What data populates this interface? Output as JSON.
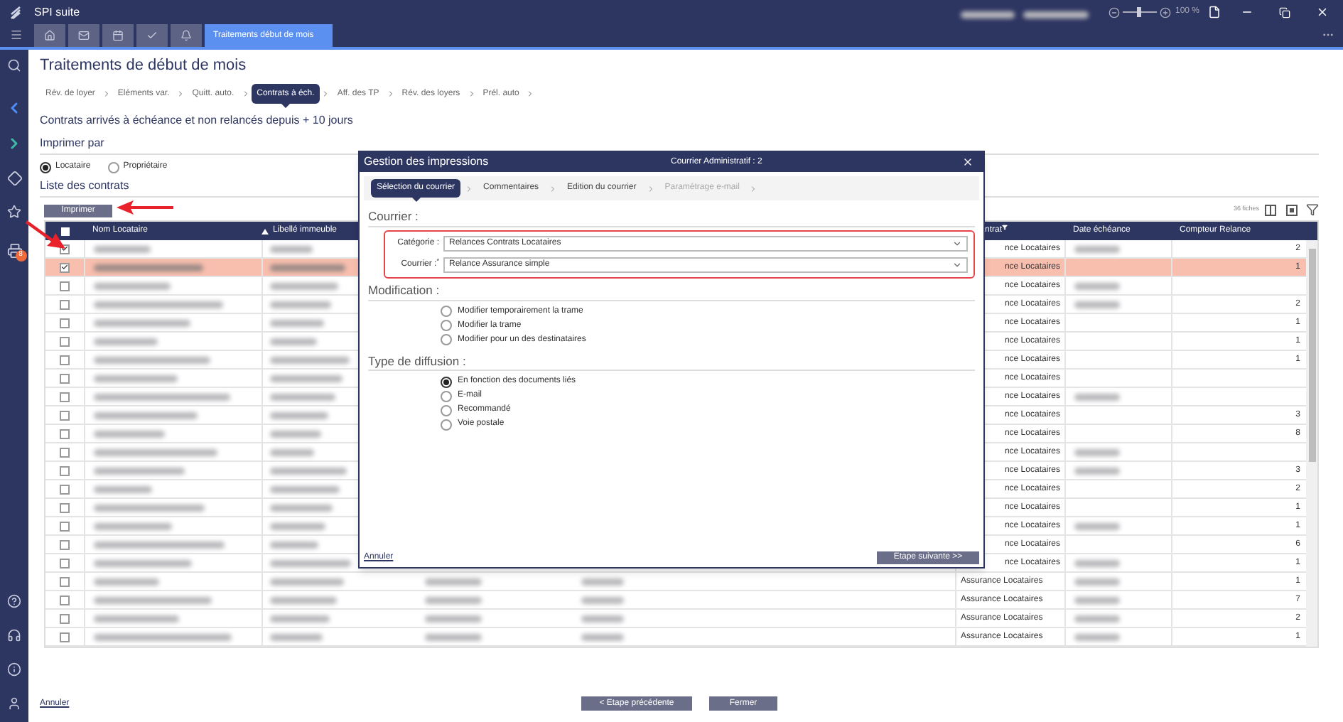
{
  "app": {
    "title": "SPI suite",
    "zoom": {
      "level": 0.5,
      "reading": "100 %"
    }
  },
  "tabs": [
    {
      "kind": "icon",
      "selected": false
    },
    {
      "kind": "icon",
      "selected": false
    },
    {
      "kind": "icon",
      "selected": false
    },
    {
      "kind": "icon",
      "selected": false
    },
    {
      "kind": "icon",
      "selected": false
    },
    {
      "kind": "text",
      "label": "Traitements début de mois",
      "selected": true
    }
  ],
  "sidebar": {
    "print_badge": "8"
  },
  "page": {
    "title": "Traitements de début de mois",
    "steps": [
      {
        "label": "Rév. de loyer",
        "selected": false
      },
      {
        "label": "Eléments var.",
        "selected": false
      },
      {
        "label": "Quitt. auto.",
        "selected": false
      },
      {
        "label": "Contrats à éch.",
        "selected": true
      },
      {
        "label": "Aff. des TP",
        "selected": false
      },
      {
        "label": "Rév. des loyers",
        "selected": false
      },
      {
        "label": "Prél. auto",
        "selected": false
      }
    ],
    "subtitle": "Contrats arrivés à échéance et non relancés depuis + 10 jours",
    "print_by": {
      "label": "Imprimer par",
      "options": [
        {
          "label": "Locataire",
          "selected": true
        },
        {
          "label": "Propriétaire",
          "selected": false
        }
      ]
    },
    "list_title": "Liste des contrats",
    "print_button": "Imprimer",
    "count": "36 fiches"
  },
  "table": {
    "select_all_partial": true,
    "columns": [
      "Nom Locataire",
      "Libellé immeuble",
      "ntrat",
      "Date échéance",
      "Compteur Relance"
    ],
    "rows": [
      {
        "kind": "under_dialog",
        "checked": true,
        "selected": false,
        "contract": "nce Locataires",
        "date_redacted": true,
        "counter": "2"
      },
      {
        "kind": "under_dialog",
        "checked": true,
        "selected": true,
        "contract": "nce Locataires",
        "date_redacted": false,
        "counter": "1"
      },
      {
        "kind": "under_dialog",
        "checked": false,
        "selected": false,
        "contract": "nce Locataires",
        "date_redacted": true
      },
      {
        "kind": "under_dialog",
        "checked": false,
        "selected": false,
        "contract": "nce Locataires",
        "date_redacted": true,
        "counter": "2"
      },
      {
        "kind": "under_dialog",
        "checked": false,
        "selected": false,
        "contract": "nce Locataires",
        "date_redacted": false,
        "counter": "1"
      },
      {
        "kind": "under_dialog",
        "checked": false,
        "selected": false,
        "contract": "nce Locataires",
        "date_redacted": false,
        "counter": "1"
      },
      {
        "kind": "under_dialog",
        "checked": false,
        "selected": false,
        "contract": "nce Locataires",
        "date_redacted": false,
        "counter": "1"
      },
      {
        "kind": "under_dialog",
        "checked": false,
        "selected": false,
        "contract": "nce Locataires",
        "date_redacted": false
      },
      {
        "kind": "under_dialog",
        "checked": false,
        "selected": false,
        "contract": "nce Locataires",
        "date_redacted": true
      },
      {
        "kind": "under_dialog",
        "checked": false,
        "selected": false,
        "contract": "nce Locataires",
        "date_redacted": false,
        "counter": "3"
      },
      {
        "kind": "under_dialog",
        "checked": false,
        "selected": false,
        "contract": "nce Locataires",
        "date_redacted": false,
        "counter": "8"
      },
      {
        "kind": "under_dialog",
        "checked": false,
        "selected": false,
        "contract": "nce Locataires",
        "date_redacted": true
      },
      {
        "kind": "under_dialog",
        "checked": false,
        "selected": false,
        "contract": "nce Locataires",
        "date_redacted": true,
        "counter": "3"
      },
      {
        "kind": "under_dialog",
        "checked": false,
        "selected": false,
        "contract": "nce Locataires",
        "date_redacted": false,
        "counter": "2"
      },
      {
        "kind": "under_dialog",
        "checked": false,
        "selected": false,
        "contract": "nce Locataires",
        "date_redacted": false,
        "counter": "1"
      },
      {
        "kind": "under_dialog",
        "checked": false,
        "selected": false,
        "contract": "nce Locataires",
        "date_redacted": true,
        "counter": "1"
      },
      {
        "kind": "under_dialog",
        "checked": false,
        "selected": false,
        "contract": "nce Locataires",
        "date_redacted": false,
        "counter": "6"
      },
      {
        "kind": "under_dialog",
        "checked": false,
        "selected": false,
        "contract": "nce Locataires",
        "date_redacted": true,
        "counter": "1"
      },
      {
        "kind": "visible",
        "checked": false,
        "selected": false,
        "contract": "Assurance Locataires",
        "date_redacted": true,
        "counter": "1"
      },
      {
        "kind": "visible",
        "checked": false,
        "selected": false,
        "contract": "Assurance Locataires",
        "date_redacted": true,
        "counter": "7"
      },
      {
        "kind": "visible",
        "checked": false,
        "selected": false,
        "contract": "Assurance Locataires",
        "date_redacted": true,
        "counter": "2"
      },
      {
        "kind": "visible",
        "checked": false,
        "selected": false,
        "contract": "Assurance Locataires",
        "date_redacted": true,
        "counter": "1"
      }
    ]
  },
  "dialog": {
    "title": "Gestion des impressions",
    "subtitle": "Courrier Administratif : 2",
    "steps": [
      {
        "label": "Sélection du courrier",
        "selected": true,
        "disabled": false
      },
      {
        "label": "Commentaires",
        "selected": false,
        "disabled": false
      },
      {
        "label": "Edition du courrier",
        "selected": false,
        "disabled": false
      },
      {
        "label": "Paramétrage e-mail",
        "selected": false,
        "disabled": true
      }
    ],
    "courrier": {
      "heading": "Courrier :",
      "fields": [
        {
          "label": "Catégorie :",
          "value": "Relances Contrats Locataires"
        },
        {
          "label": "Courrier :$^{*}$",
          "value": "Relance Assurance simple"
        }
      ]
    },
    "modification": {
      "heading": "Modification :",
      "options": [
        {
          "label": "Modifier temporairement la trame",
          "selected": false
        },
        {
          "label": "Modifier la trame",
          "selected": false
        },
        {
          "label": "Modifier pour un des destinataires",
          "selected": false
        }
      ]
    },
    "diffusion": {
      "heading": "Type de diffusion :",
      "options": [
        {
          "label": "En fonction des documents liés",
          "selected": true
        },
        {
          "label": "E-mail",
          "selected": false
        },
        {
          "label": "Recommandé",
          "selected": false
        },
        {
          "label": "Voie postale",
          "selected": false
        }
      ]
    },
    "cancel": "Annuler",
    "next": "Etape suivante >>"
  },
  "footer": {
    "cancel": "Annuler",
    "previous": "< Etape précédente",
    "close": "Fermer"
  }
}
